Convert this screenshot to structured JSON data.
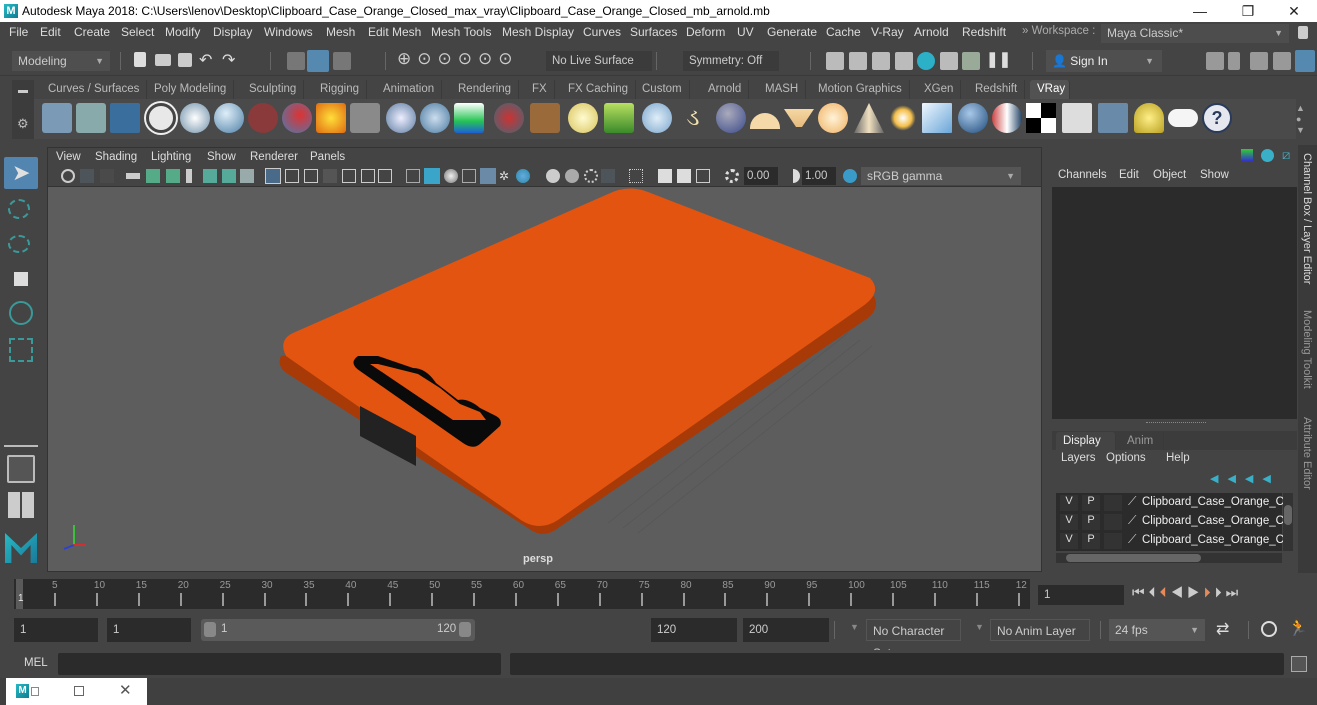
{
  "titlebar": {
    "title": "Autodesk Maya 2018: C:\\Users\\lenov\\Desktop\\Clipboard_Case_Orange_Closed_max_vray\\Clipboard_Case_Orange_Closed_mb_arnold.mb",
    "logo": "M",
    "minimize": "—",
    "maximize": "❐",
    "close": "✕"
  },
  "menubar": {
    "items": [
      "File",
      "Edit",
      "Create",
      "Select",
      "Modify",
      "Display",
      "Windows",
      "Mesh",
      "Edit Mesh",
      "Mesh Tools",
      "Mesh Display",
      "Curves",
      "Surfaces",
      "Deform",
      "UV",
      "Generate",
      "Cache",
      "V-Ray",
      "Arnold",
      "Redshift"
    ],
    "workspace_label": "» Workspace :",
    "workspace_value": "Maya Classic*"
  },
  "statusline": {
    "mode": "Modeling",
    "live_surface": "No Live Surface",
    "symmetry": "Symmetry: Off",
    "sign_in": "Sign In"
  },
  "shelf": {
    "tabs": [
      "Curves / Surfaces",
      "Poly Modeling",
      "Sculpting",
      "Rigging",
      "Animation",
      "Rendering",
      "FX",
      "FX Caching",
      "Custom",
      "Arnold",
      "MASH",
      "Motion Graphics",
      "XGen",
      "Redshift",
      "VRay"
    ],
    "active_tab": "VRay",
    "icons": [
      "vray-export-icon",
      "vray-import-icon",
      "vray-list-icon",
      "vray-logo-icon",
      "vray-doc-icon",
      "vray-sphere-icon",
      "vray-camera-icon",
      "vray-molecules-icon",
      "vray-fire-icon",
      "vray-plane-icon",
      "vray-box-icon",
      "vray-cone-icon",
      "vray-light-icon",
      "vray-fur-icon",
      "vray-wood-icon",
      "vray-dome-icon",
      "vray-grass-icon",
      "vray-cluster-icon",
      "vray-curve-icon",
      "vray-globe-icon",
      "vray-dome-light-icon",
      "vray-spot-icon",
      "vray-sphere-light-icon",
      "vray-ies-icon",
      "vray-sun-icon",
      "vray-sky-icon",
      "vray-material-icon",
      "vray-blend-icon",
      "vray-checker-icon",
      "vray-fb-icon",
      "vray-settings-icon",
      "vray-lightlister-icon",
      "vray-cloud-icon",
      "help-icon"
    ]
  },
  "viewport": {
    "menus": [
      "View",
      "Shading",
      "Lighting",
      "Show",
      "Renderer",
      "Panels"
    ],
    "exposure": "0.00",
    "gamma": "1.00",
    "color_space": "sRGB gamma",
    "camera_label": "persp",
    "object_color": "#e0540f"
  },
  "channelbox": {
    "menus": [
      "Channels",
      "Edit",
      "Object",
      "Show"
    ]
  },
  "layereditor": {
    "tabs": [
      "Display",
      "Anim"
    ],
    "active_tab": "Display",
    "menus": [
      "Layers",
      "Options",
      "Help"
    ],
    "layers": [
      {
        "v": "V",
        "p": "P",
        "name": "Clipboard_Case_Orange_Clo"
      },
      {
        "v": "V",
        "p": "P",
        "name": "Clipboard_Case_Orange_Clo"
      },
      {
        "v": "V",
        "p": "P",
        "name": "Clipboard_Case_Orange_Clo"
      }
    ]
  },
  "sidetabs": [
    "Channel Box / Layer Editor",
    "Modeling Toolkit",
    "Attribute Editor"
  ],
  "timeline": {
    "ticks": [
      "5",
      "10",
      "15",
      "20",
      "25",
      "30",
      "35",
      "40",
      "45",
      "50",
      "55",
      "60",
      "65",
      "70",
      "75",
      "80",
      "85",
      "90",
      "95",
      "100",
      "105",
      "110",
      "115",
      "12"
    ],
    "current_frame_marker": "1",
    "current_frame": "1"
  },
  "range": {
    "start": "1",
    "playback_start": "1",
    "slider_start": "1",
    "slider_end": "120",
    "playback_end": "120",
    "end": "200",
    "character_set": "No Character Set",
    "anim_layer": "No Anim Layer",
    "fps": "24 fps"
  },
  "mel": {
    "label": "MEL"
  },
  "taskbar": {
    "logo": "M"
  }
}
